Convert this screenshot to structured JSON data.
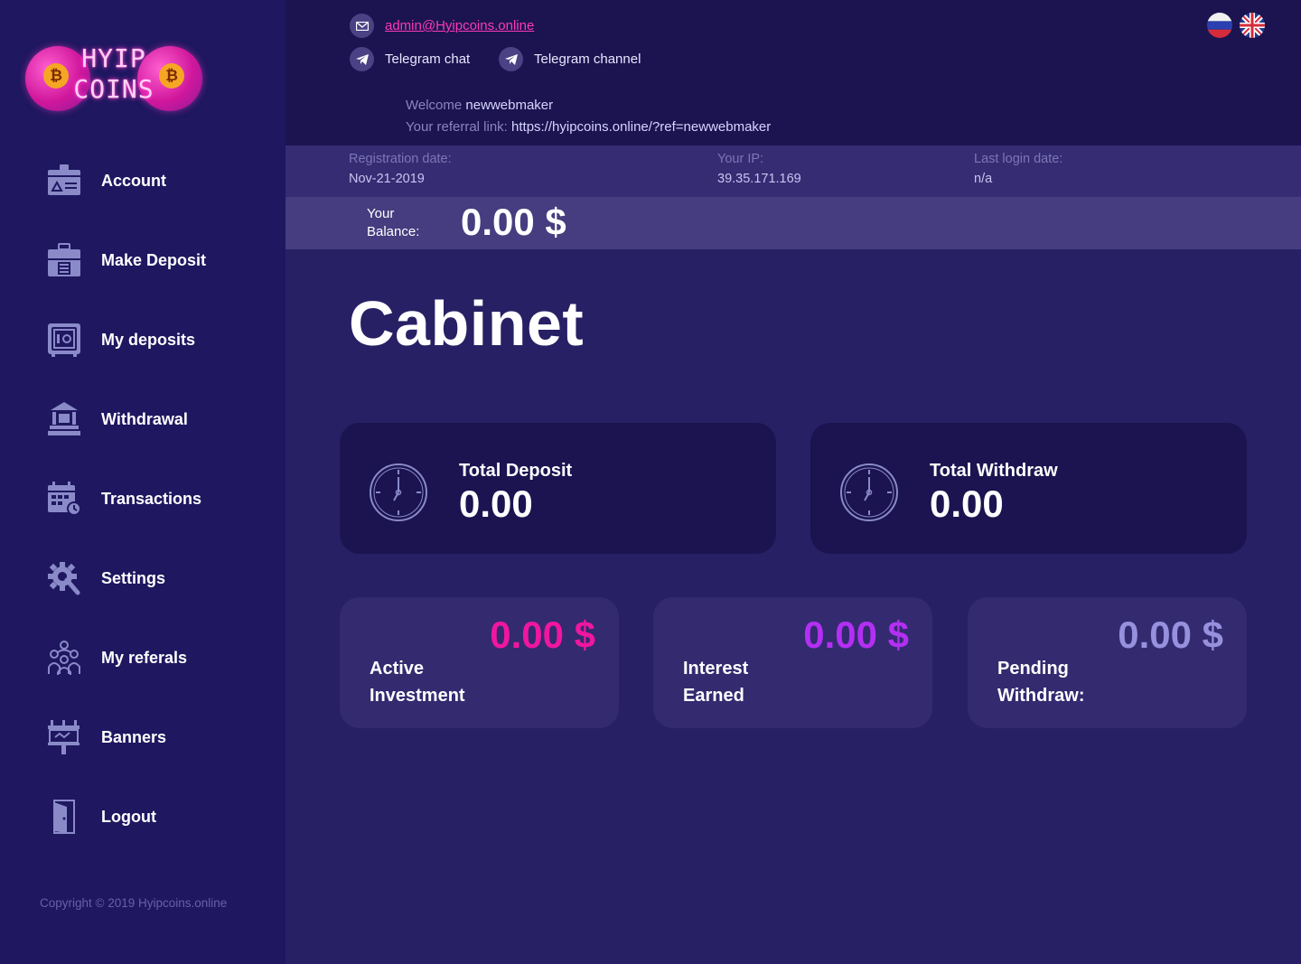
{
  "logo": {
    "line1": "HYIP",
    "line2": "COINS",
    "coin_symbol": "₿"
  },
  "sidebar": {
    "items": [
      {
        "label": "Account",
        "icon": "account-card-icon"
      },
      {
        "label": "Make Deposit",
        "icon": "briefcase-icon"
      },
      {
        "label": "My deposits",
        "icon": "safe-icon"
      },
      {
        "label": "Withdrawal",
        "icon": "bank-icon"
      },
      {
        "label": "Transactions",
        "icon": "calendar-icon"
      },
      {
        "label": "Settings",
        "icon": "gear-icon"
      },
      {
        "label": "My referals",
        "icon": "people-icon"
      },
      {
        "label": "Banners",
        "icon": "billboard-icon"
      },
      {
        "label": "Logout",
        "icon": "door-icon"
      }
    ],
    "copyright": "Copyright © 2019 Hyipcoins.online"
  },
  "header": {
    "email": "admin@Hyipcoins.online",
    "telegram_chat": "Telegram chat",
    "telegram_channel": "Telegram channel",
    "welcome_prefix": "Welcome",
    "username": "newwebmaker",
    "referral_prefix": "Your referral link:",
    "referral_link": "https://hyipcoins.online/?ref=newwebmaker"
  },
  "info": {
    "registration_label": "Registration date:",
    "registration_value": "Nov-21-2019",
    "ip_label": "Your IP:",
    "ip_value": "39.35.171.169",
    "last_login_label": "Last login date:",
    "last_login_value": "n/a"
  },
  "balance": {
    "label_line1": "Your",
    "label_line2": "Balance:",
    "value": "0.00 $"
  },
  "page_title": "Cabinet",
  "totals": {
    "deposit_title": "Total Deposit",
    "deposit_value": "0.00",
    "withdraw_title": "Total Withdraw",
    "withdraw_value": "0.00"
  },
  "stats": [
    {
      "value": "0.00 $",
      "line1": "Active",
      "line2": "Investment",
      "color": "#f0169f"
    },
    {
      "value": "0.00 $",
      "line1": "Interest",
      "line2": "Earned",
      "color": "#b32ff2"
    },
    {
      "value": "0.00 $",
      "line1": "Pending",
      "line2": "Withdraw:",
      "color": "#9690dd"
    }
  ],
  "colors": {
    "sidebar_bg": "#1f1760",
    "main_bg": "#282064",
    "accent_pink": "#ff39b8"
  }
}
